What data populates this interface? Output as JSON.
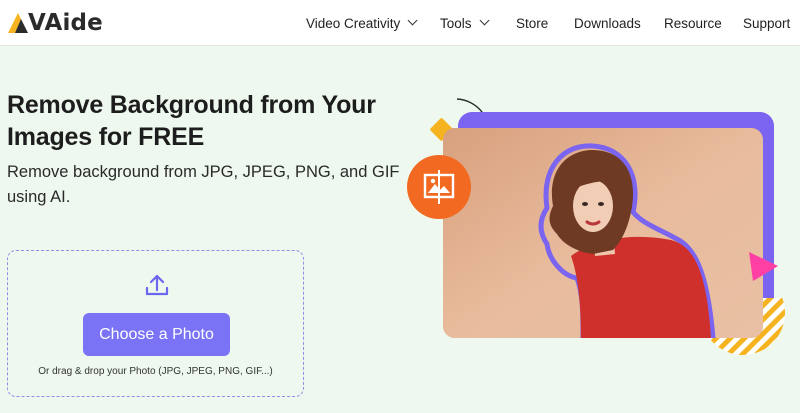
{
  "header": {
    "logo_text": "VAide",
    "nav": [
      {
        "label": "Video Creativity",
        "has_dropdown": true
      },
      {
        "label": "Tools",
        "has_dropdown": true
      },
      {
        "label": "Store",
        "has_dropdown": false
      },
      {
        "label": "Downloads",
        "has_dropdown": false
      },
      {
        "label": "Resource",
        "has_dropdown": false
      },
      {
        "label": "Support",
        "has_dropdown": false
      }
    ]
  },
  "hero": {
    "title": "Remove Background from Your Images for FREE",
    "subtitle": "Remove background from JPG, JPEG, PNG, and GIF using AI."
  },
  "upload": {
    "button_label": "Choose a Photo",
    "drag_hint": "Or drag & drop your Photo (JPG, JPEG, PNG, GIF...)",
    "upload_icon": "upload-icon"
  },
  "colors": {
    "page_background": "#eef8ee",
    "accent": "#7a73f5",
    "frame_purple": "#7a64f0",
    "badge_orange": "#f26a22",
    "shape_yellow": "#f5b41f",
    "triangle_pink": "#ff3fa4"
  }
}
